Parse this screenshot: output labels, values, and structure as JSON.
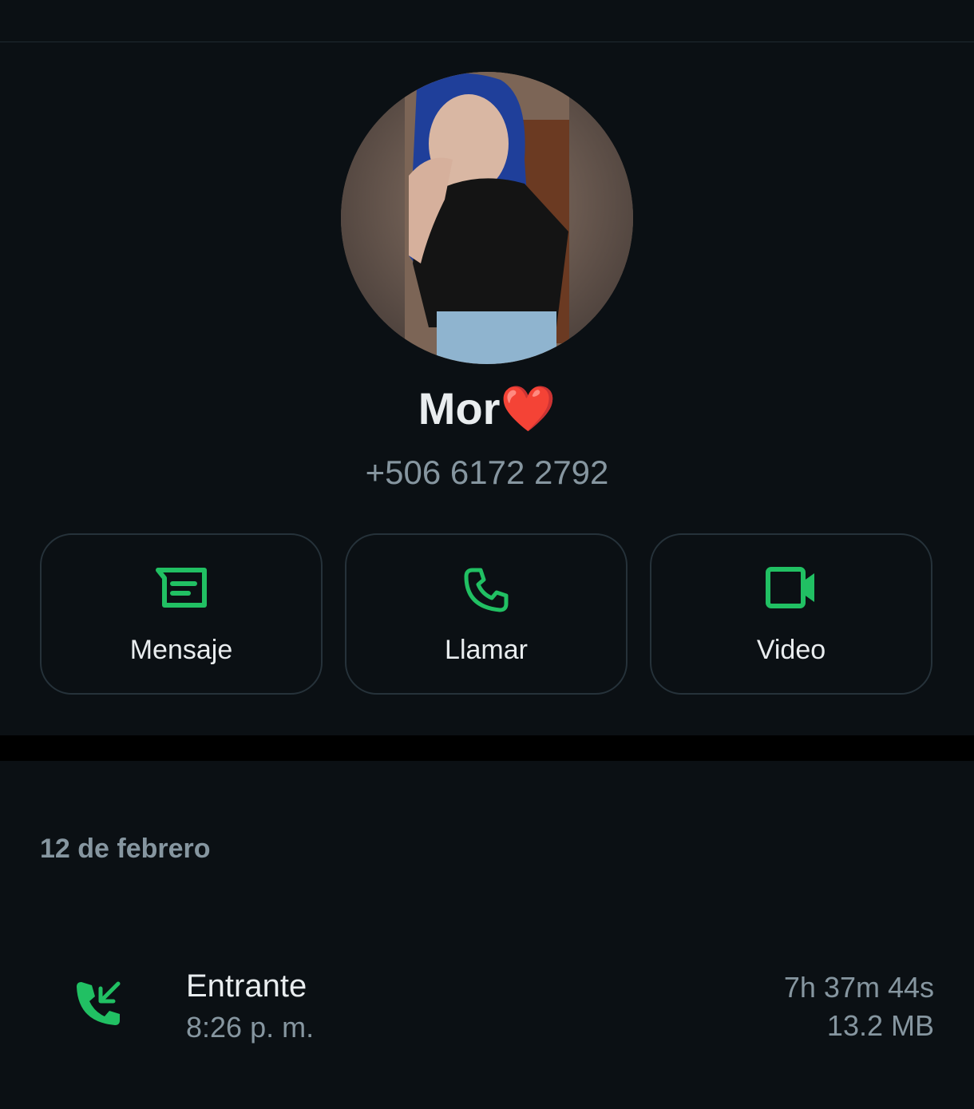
{
  "contact": {
    "name": "Mor",
    "name_emoji": "❤️",
    "phone": "+506 6172 2792"
  },
  "actions": [
    {
      "label": "Mensaje",
      "icon": "message-icon"
    },
    {
      "label": "Llamar",
      "icon": "phone-icon"
    },
    {
      "label": "Video",
      "icon": "video-icon"
    }
  ],
  "history": {
    "date": "12 de febrero",
    "calls": [
      {
        "type": "Entrante",
        "time": "8:26 p. m.",
        "duration": "7h 37m 44s",
        "size": "13.2 MB",
        "icon": "incoming-call-icon"
      }
    ]
  },
  "colors": {
    "background": "#0b1014",
    "accent": "#21c063",
    "text_primary": "#e9edef",
    "text_secondary": "#8696a0"
  }
}
